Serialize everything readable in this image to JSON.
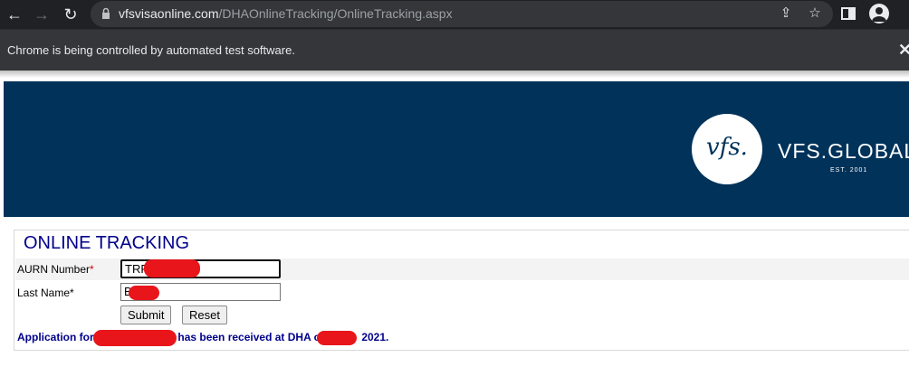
{
  "browser": {
    "url_host": "vfsvisaonline.com",
    "url_path": "/DHAOnlineTracking/OnlineTracking.aspx",
    "infobar_text": "Chrome is being controlled by automated test software.",
    "icons": [
      "back-arrow-icon",
      "forward-arrow-icon",
      "reload-icon",
      "lock-icon",
      "share-icon",
      "star-icon",
      "side-panel-icon",
      "profile-icon",
      "close-icon"
    ]
  },
  "banner": {
    "logo_mark": "vfs.",
    "brand": "VFS.GLOBAL",
    "est": "EST. 2001",
    "background": "#00325a"
  },
  "form": {
    "title": "ONLINE TRACKING",
    "aurn_label": "AURN Number",
    "aurn_value": "TRR",
    "lastname_label": "Last Name",
    "lastname_value": "B",
    "required_mark": "*",
    "submit_label": "Submit",
    "reset_label": "Reset",
    "message_part1": "Application for",
    "message_part2": "has been received at DHA o",
    "message_part3": "2021."
  }
}
